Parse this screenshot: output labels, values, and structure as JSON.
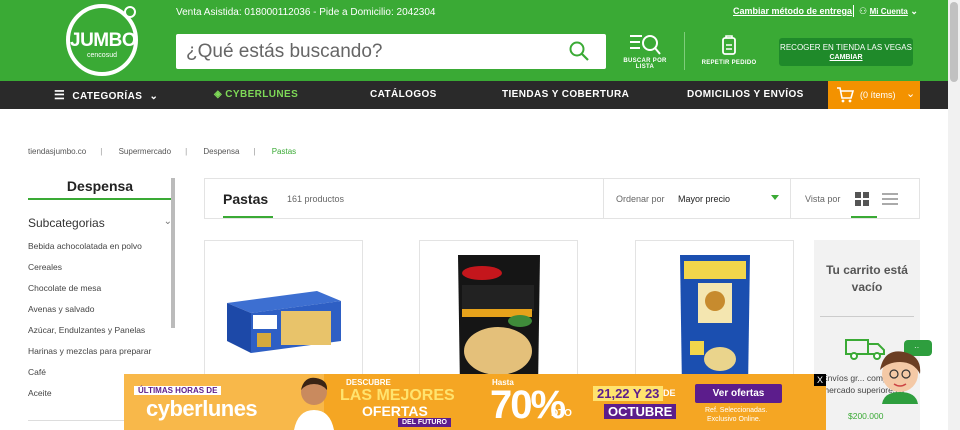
{
  "brand": {
    "name": "JUMBO",
    "sub": "cencosud"
  },
  "header": {
    "topline": "Venta Asistida: 018000112036 - Pide a Domicilio: 2042304",
    "change_delivery": "Cambiar método de entrega",
    "account": "Mi Cuenta",
    "search_placeholder": "¿Qué estás buscando?",
    "list_search": "BUSCAR POR LISTA",
    "repeat_order": "REPETIR PEDIDO",
    "store_pickup": "RECOGER EN TIENDA LAS VEGAS",
    "store_change": "CAMBIAR"
  },
  "nav": {
    "categories": "CATEGORÍAS",
    "cyberlunes": "CYBERLUNES",
    "catalogs": "CATÁLOGOS",
    "stores": "TIENDAS Y COBERTURA",
    "delivery": "DOMICILIOS Y ENVÍOS",
    "cart": "(0 ítems)"
  },
  "breadcrumb": [
    "tiendasjumbo.co",
    "Supermercado",
    "Despensa",
    "Pastas"
  ],
  "sidebar": {
    "title": "Despensa",
    "subcategories": "Subcategorias",
    "items": [
      "Bebida achocolatada en polvo",
      "Cereales",
      "Chocolate de mesa",
      "Avenas y salvado",
      "Azúcar, Endulzantes y Panelas",
      "Harinas y mezclas para preparar",
      "Café",
      "Aceite"
    ]
  },
  "toolbar": {
    "title": "Pastas",
    "count": "161 productos",
    "order_label": "Ordenar por",
    "order_value": "Mayor precio",
    "view_label": "Vista por"
  },
  "mini_cart": {
    "title": "Tu carrito está vacío",
    "shipping": "Envíos gr... compras mercado superiores a",
    "shipping_amount": "$200.000"
  },
  "banner": {
    "top": "ÚLTIMAS HORAS DE",
    "brand": "cyberlunes",
    "discover": "DESCUBRE",
    "best": "LAS MEJORES",
    "offers": "OFERTAS",
    "future": "DEL FUTURO",
    "upto": "Hasta",
    "percent": "70%",
    "dto": "DTO",
    "dates": "21,22 Y 23",
    "de": "DE",
    "month": "OCTUBRE",
    "cta": "Ver ofertas",
    "note1": "Ref. Seleccionadas.",
    "note2": "Exclusivo Online.",
    "close": "X"
  },
  "colors": {
    "brand_green": "#3aaa35",
    "nav_dark": "#2a2a2a",
    "cart_orange": "#f39200",
    "cta_purple": "#5c1d8c"
  }
}
